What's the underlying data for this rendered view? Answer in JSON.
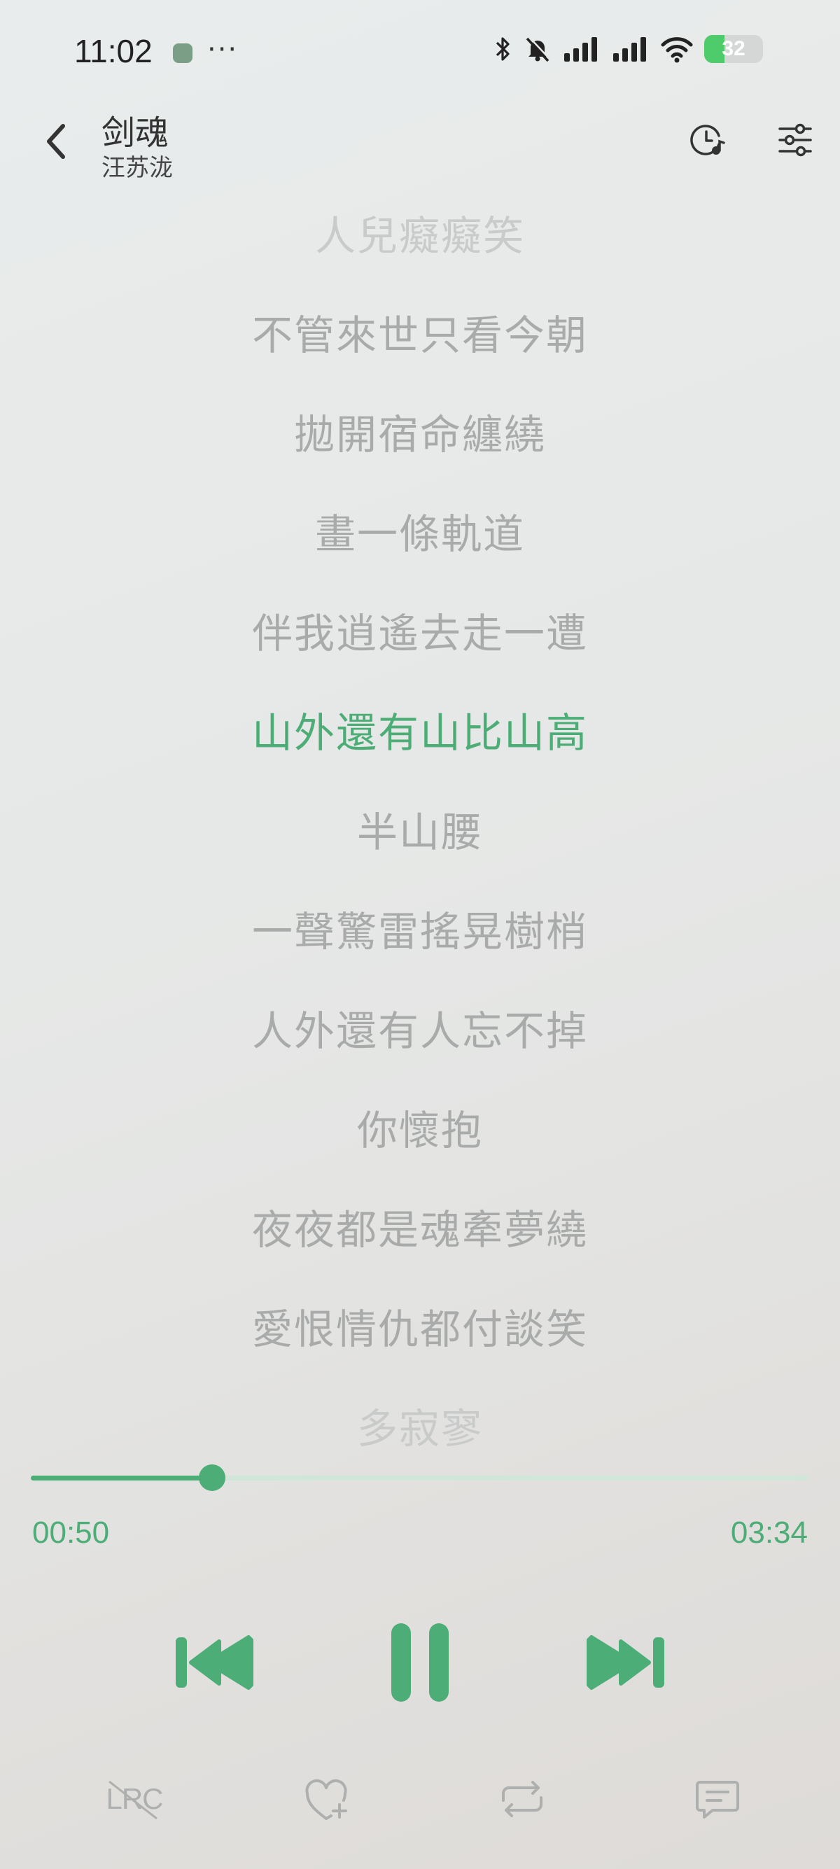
{
  "status_bar": {
    "time": "11:02",
    "dots": "···",
    "battery_level": "32",
    "icons": [
      "app-notification-icon",
      "bluetooth-icon",
      "mute-bell-icon",
      "signal-icon",
      "signal-icon",
      "wifi-icon",
      "battery-icon"
    ]
  },
  "header": {
    "title": "剑魂",
    "artist": "汪苏泷",
    "icons": [
      "back-icon",
      "timer-icon",
      "settings-sliders-icon"
    ]
  },
  "lyrics": {
    "lines": [
      "人兒癡癡笑",
      "不管來世只看今朝",
      "拋開宿命纏繞",
      "畫一條軌道",
      "伴我逍遙去走一遭",
      "山外還有山比山高",
      "半山腰",
      "一聲驚雷搖晃樹梢",
      "人外還有人忘不掉",
      "你懷抱",
      "夜夜都是魂牽夢繞",
      "愛恨情仇都付談笑",
      "多寂寥"
    ],
    "current_index": 5
  },
  "playback": {
    "elapsed": "00:50",
    "total": "03:34",
    "progress_fraction": 0.2336
  },
  "controls": {
    "icons": [
      "previous-icon",
      "pause-icon",
      "next-icon"
    ]
  },
  "bottom_bar": {
    "lrc_label": "LRC",
    "icons": [
      "lyrics-off-icon",
      "favorite-heart-icon",
      "repeat-icon",
      "comment-icon"
    ]
  },
  "colors": {
    "accent": "#4cad76",
    "lyric_inactive": "#a9abab",
    "track": "#cfe6d8"
  }
}
